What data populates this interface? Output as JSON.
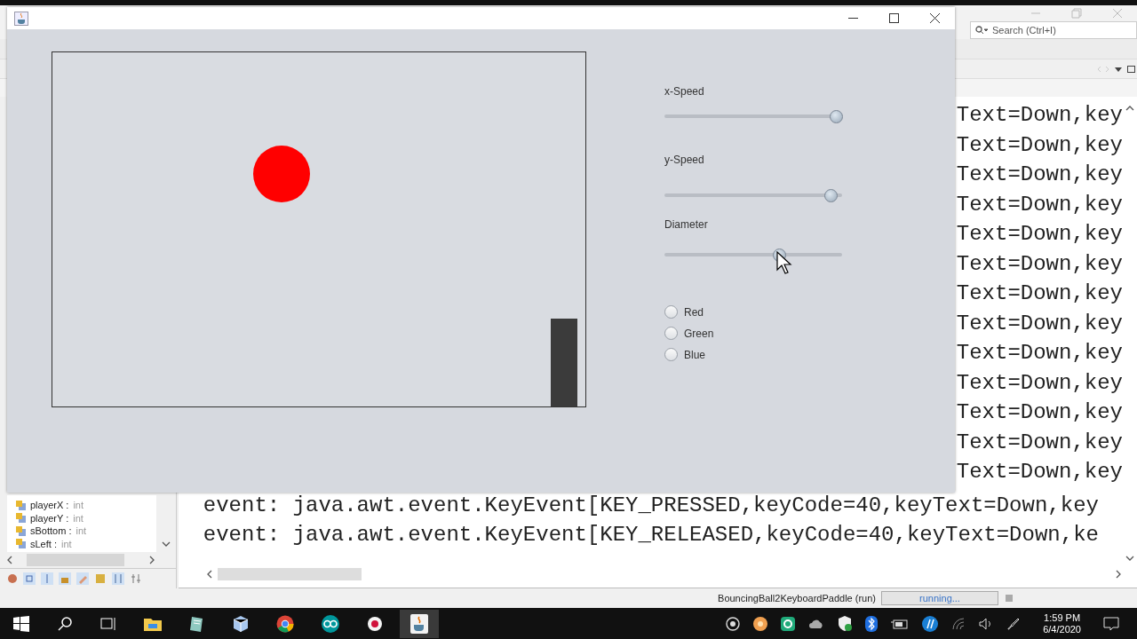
{
  "ide": {
    "search": {
      "placeholder": "Search (Ctrl+I)"
    },
    "output_lines_partial": [
      "Text=Down,key",
      "Text=Down,key",
      "Text=Down,key",
      "Text=Down,key",
      "Text=Down,key",
      "Text=Down,key",
      "Text=Down,key",
      "Text=Down,key",
      "Text=Down,key",
      "Text=Down,key",
      "Text=Down,key",
      "Text=Down,key",
      "Text=Down,key"
    ],
    "output_lines": [
      "event: java.awt.event.KeyEvent[KEY_PRESSED,keyCode=40,keyText=Down,key",
      "event: java.awt.event.KeyEvent[KEY_RELEASED,keyCode=40,keyText=Down,ke"
    ],
    "navigator_items": [
      {
        "name": "playerX :",
        "type": "int"
      },
      {
        "name": "playerY :",
        "type": "int"
      },
      {
        "name": "sBottom :",
        "type": "int"
      },
      {
        "name": "sLeft :",
        "type": "int"
      }
    ],
    "status": {
      "task": "BouncingBall2KeyboardPaddle (run)",
      "progress_text": "running..."
    }
  },
  "app_window": {
    "sliders": [
      {
        "label": "x-Speed",
        "level": 0.965
      },
      {
        "label": "y-Speed",
        "level": 0.935
      },
      {
        "label": "Diameter",
        "level": 0.645
      }
    ],
    "radios": [
      {
        "label": "Red",
        "selected": false
      },
      {
        "label": "Green",
        "selected": false
      },
      {
        "label": "Blue",
        "selected": false
      }
    ]
  },
  "taskbar": {
    "time": "1:59 PM",
    "date": "6/4/2020"
  }
}
